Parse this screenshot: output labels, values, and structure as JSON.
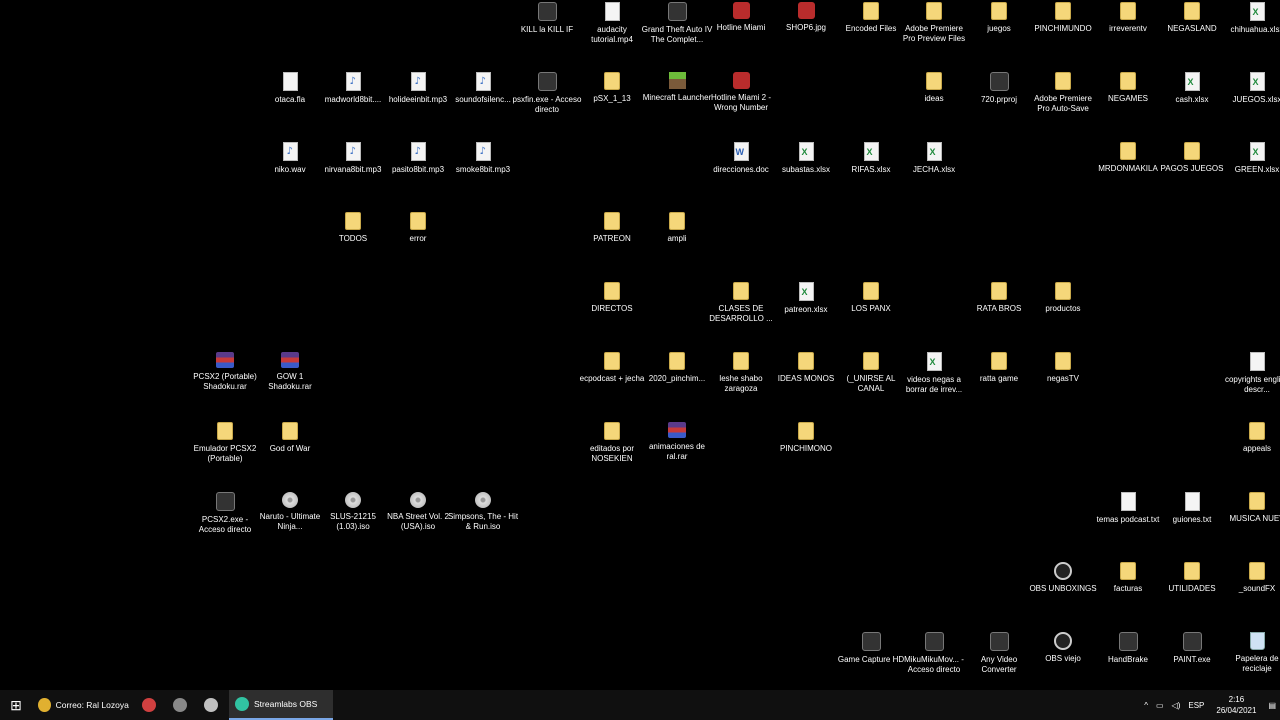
{
  "desktop_icons": [
    {
      "label": "KILL la KILL IF",
      "type": "app"
    },
    {
      "label": "audacity tutorial.mp4",
      "type": "file"
    },
    {
      "label": "Grand Theft Auto IV The Complet...",
      "type": "app"
    },
    {
      "label": "Hotline Miami",
      "type": "red"
    },
    {
      "label": "SHOP6.jpg",
      "type": "red"
    },
    {
      "label": "Encoded Files",
      "type": "folder"
    },
    {
      "label": "Adobe Premiere Pro Preview Files",
      "type": "folder"
    },
    {
      "label": "juegos",
      "type": "folder"
    },
    {
      "label": "PINCHIMUNDO",
      "type": "folder"
    },
    {
      "label": "irreverentv",
      "type": "folder"
    },
    {
      "label": "NEGASLAND",
      "type": "folder"
    },
    {
      "label": "chihuahua.xlsx",
      "type": "excel"
    },
    {
      "label": "otaca.fla",
      "type": "file"
    },
    {
      "label": "madworld8bit....",
      "type": "audio"
    },
    {
      "label": "holideeinbit.mp3",
      "type": "audio"
    },
    {
      "label": "soundofsilenc...",
      "type": "audio"
    },
    {
      "label": "psxfin.exe - Acceso directo",
      "type": "app"
    },
    {
      "label": "pSX_1_13",
      "type": "folder"
    },
    {
      "label": "Minecraft Launcher",
      "type": "mc"
    },
    {
      "label": "Hotline Miami 2 - Wrong Number",
      "type": "red"
    },
    {
      "label": "ideas",
      "type": "folder"
    },
    {
      "label": "720.prproj",
      "type": "app"
    },
    {
      "label": "Adobe Premiere Pro Auto-Save",
      "type": "folder"
    },
    {
      "label": "NEGAMES",
      "type": "folder"
    },
    {
      "label": "cash.xlsx",
      "type": "excel"
    },
    {
      "label": "JUEGOS.xlsx",
      "type": "excel"
    },
    {
      "label": "niko.wav",
      "type": "audio"
    },
    {
      "label": "nirvana8bit.mp3",
      "type": "audio"
    },
    {
      "label": "pasito8bit.mp3",
      "type": "audio"
    },
    {
      "label": "smoke8bit.mp3",
      "type": "audio"
    },
    {
      "label": "direcciones.doc",
      "type": "doc"
    },
    {
      "label": "subastas.xlsx",
      "type": "excel"
    },
    {
      "label": "RIFAS.xlsx",
      "type": "excel"
    },
    {
      "label": "JECHA.xlsx",
      "type": "excel"
    },
    {
      "label": "MRDONMAKILA",
      "type": "folder"
    },
    {
      "label": "PAGOS JUEGOS",
      "type": "folder"
    },
    {
      "label": "GREEN.xlsx",
      "type": "excel"
    },
    {
      "label": "TODOS",
      "type": "folder"
    },
    {
      "label": "error",
      "type": "folder"
    },
    {
      "label": "PATREON",
      "type": "folder"
    },
    {
      "label": "ampli",
      "type": "folder"
    },
    {
      "label": "DIRECTOS",
      "type": "folder"
    },
    {
      "label": "CLASES DE DESARROLLO ...",
      "type": "folder"
    },
    {
      "label": "patreon.xlsx",
      "type": "excel"
    },
    {
      "label": "LOS PANX",
      "type": "folder"
    },
    {
      "label": "RATA BROS",
      "type": "folder"
    },
    {
      "label": "productos",
      "type": "folder"
    },
    {
      "label": "PCSX2 (Portable) Shadoku.rar",
      "type": "rar"
    },
    {
      "label": "GOW 1 Shadoku.rar",
      "type": "rar"
    },
    {
      "label": "ecpodcast + jecha",
      "type": "folder"
    },
    {
      "label": "2020_pinchim...",
      "type": "folder"
    },
    {
      "label": "leshe shabo zaragoza",
      "type": "folder"
    },
    {
      "label": "IDEAS MONOS",
      "type": "folder"
    },
    {
      "label": "(_UNIRSE AL CANAL",
      "type": "folder"
    },
    {
      "label": "videos negas a borrar de irrev...",
      "type": "excel"
    },
    {
      "label": "ratta game",
      "type": "folder"
    },
    {
      "label": "negasTV",
      "type": "folder"
    },
    {
      "label": "copyrights english descr...",
      "type": "file"
    },
    {
      "label": "Emulador PCSX2 (Portable)",
      "type": "folder"
    },
    {
      "label": "God of War",
      "type": "folder"
    },
    {
      "label": "editados por NOSEKIEN",
      "type": "folder"
    },
    {
      "label": "animaciones de ral.rar",
      "type": "rar"
    },
    {
      "label": "PINCHIMONO",
      "type": "folder"
    },
    {
      "label": "appeals",
      "type": "folder"
    },
    {
      "label": "PCSX2.exe - Acceso directo",
      "type": "app"
    },
    {
      "label": "Naruto - Ultimate Ninja...",
      "type": "disc"
    },
    {
      "label": "SLUS-21215 (1.03).iso",
      "type": "disc"
    },
    {
      "label": "NBA Street Vol. 2 (USA).iso",
      "type": "disc"
    },
    {
      "label": "Simpsons, The - Hit & Run.iso",
      "type": "disc"
    },
    {
      "label": "temas podcast.txt",
      "type": "file"
    },
    {
      "label": "guiones.txt",
      "type": "file"
    },
    {
      "label": "MUSICA NUEV",
      "type": "folder"
    },
    {
      "label": "OBS UNBOXINGS",
      "type": "obs"
    },
    {
      "label": "facturas",
      "type": "folder"
    },
    {
      "label": "UTILIDADES",
      "type": "folder"
    },
    {
      "label": "_soundFX",
      "type": "folder"
    },
    {
      "label": "Game Capture HD",
      "type": "app"
    },
    {
      "label": "MikuMikuMov... - Acceso directo",
      "type": "app"
    },
    {
      "label": "Any Video Converter",
      "type": "app"
    },
    {
      "label": "OBS viejo",
      "type": "obs"
    },
    {
      "label": "HandBrake",
      "type": "app"
    },
    {
      "label": "PAINT.exe",
      "type": "app"
    },
    {
      "label": "Papelera de reciclaje",
      "type": "bin"
    }
  ],
  "taskbar": {
    "start_icon": "windows-icon",
    "apps": [
      {
        "label": "Correo: Ral Lozoya ...",
        "icon": "chrome-icon",
        "color": "#e0b030"
      },
      {
        "label": "",
        "icon": "app-icon-1",
        "color": "#d04040"
      },
      {
        "label": "",
        "icon": "app-icon-2",
        "color": "#888888"
      },
      {
        "label": "",
        "icon": "app-icon-3",
        "color": "#c0c0c0"
      },
      {
        "label": "Streamlabs OBS",
        "icon": "streamlabs-icon",
        "color": "#31c3a2"
      }
    ],
    "language": "ESP",
    "time": "2:16",
    "date": "26/04/2021"
  }
}
